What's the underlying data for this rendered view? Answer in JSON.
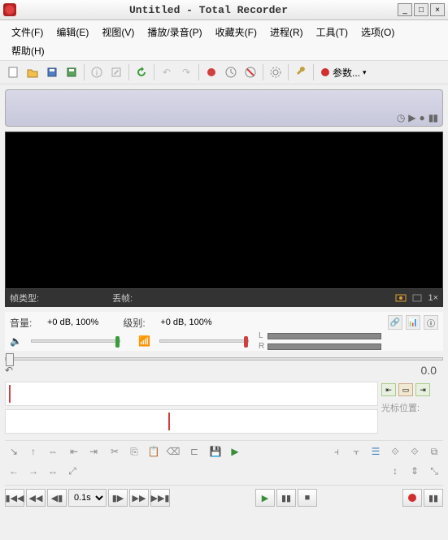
{
  "window": {
    "title": "Untitled - Total Recorder",
    "min": "_",
    "max": "□",
    "close": "×"
  },
  "menu": {
    "file": "文件(F)",
    "edit": "编辑(E)",
    "view": "视图(V)",
    "play": "播放/录音(P)",
    "fav": "收藏夹(F)",
    "process": "进程(R)",
    "tools": "工具(T)",
    "options": "选项(O)",
    "help": "帮助(H)"
  },
  "toolbar": {
    "params_label": "参数...",
    "params_arrow": "▾"
  },
  "status": {
    "frame_type": "帧类型:",
    "drop_frame": "丢帧:",
    "zoom": "1×"
  },
  "audio": {
    "volume_label": "音量:",
    "volume_value": "+0 dB, 100%",
    "level_label": "级别:",
    "level_value": "+0 dB, 100%",
    "left": "L",
    "right": "R"
  },
  "timeline": {
    "time": "0.0"
  },
  "cursor": {
    "label": "光标位置:"
  },
  "playback": {
    "interval": "0.1s"
  }
}
